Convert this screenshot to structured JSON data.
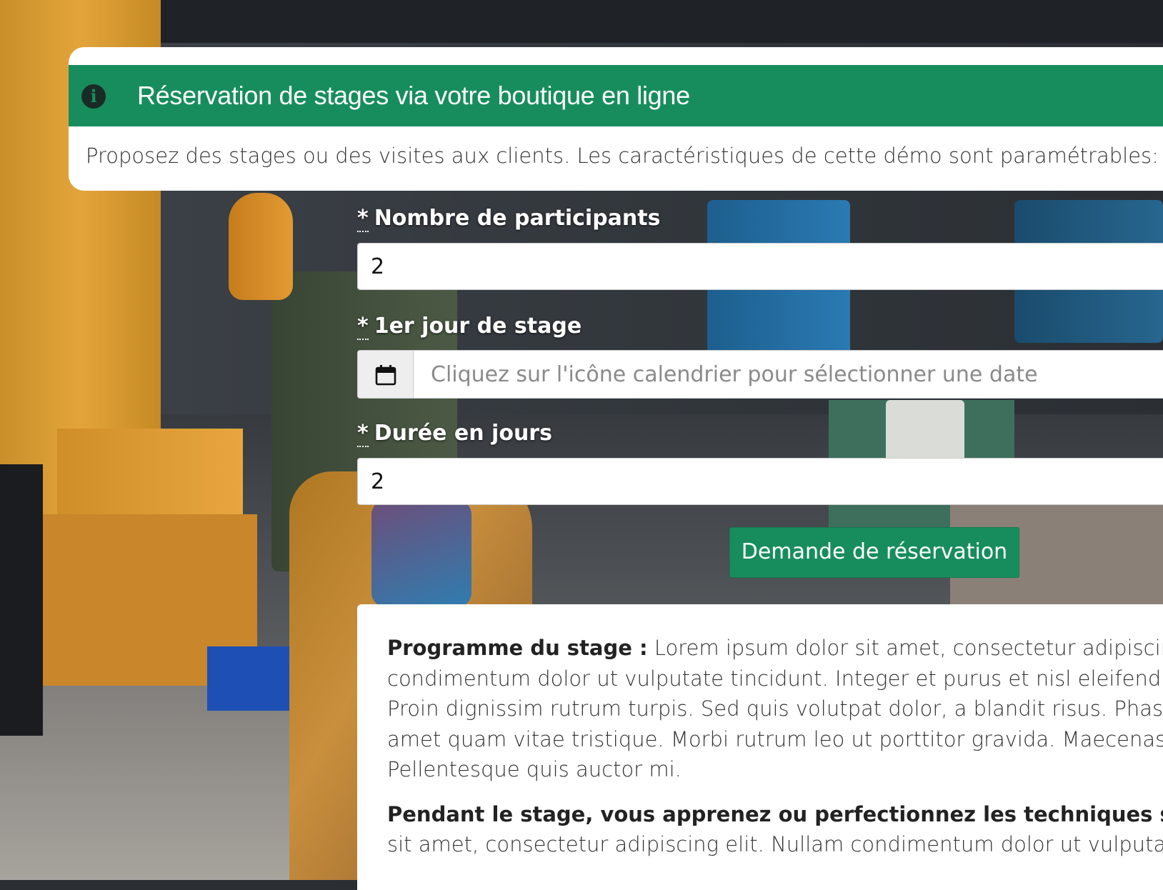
{
  "banner": {
    "icon": "info-circle-icon",
    "title": "Réservation de stages via votre boutique en ligne",
    "description": "Proposez des stages ou des visites aux clients. Les caractéristiques de cette démo sont paramétrables: no"
  },
  "form": {
    "participants": {
      "required_mark": "*",
      "label": "Nombre de participants",
      "value": "2"
    },
    "start_day": {
      "required_mark": "*",
      "label": "1er jour de stage",
      "icon": "calendar-icon",
      "placeholder": "Cliquez sur l'icône calendrier pour sélectionner une date"
    },
    "duration": {
      "required_mark": "*",
      "label": "Durée en jours",
      "value": "2"
    },
    "submit_label": "Demande de réservation"
  },
  "program": {
    "heading": "Programme du stage :",
    "lines": [
      " Lorem ipsum dolor sit amet, consectetur adipiscing",
      "condimentum dolor ut vulputate tincidunt. Integer et purus et nisl eleifend",
      "Proin dignissim rutrum turpis. Sed quis volutpat dolor, a blandit risus. Phas",
      "amet quam vitae tristique. Morbi rutrum leo ut porttitor gravida. Maecenas",
      "Pellentesque quis auctor mi."
    ],
    "techniques_heading": "Pendant le stage, vous apprenez ou perfectionnez les techniques suivar",
    "techniques_line": "sit amet, consectetur adipiscing elit. Nullam condimentum dolor ut vulputa"
  },
  "colors": {
    "accent": "#178d5d",
    "panel_bg": "#ffffff"
  }
}
